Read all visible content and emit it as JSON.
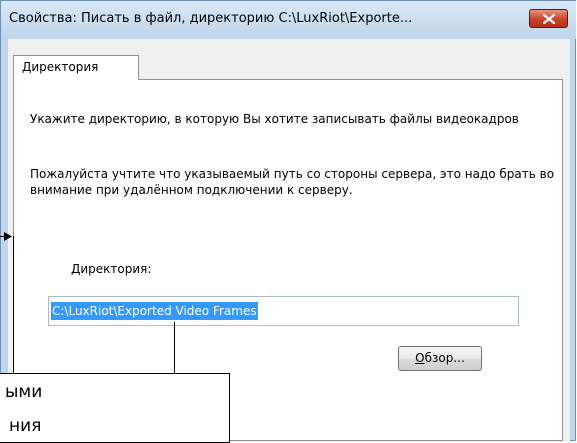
{
  "window": {
    "title": "Свойства: Писать в файл, директорию C:\\LuxRiot\\Exporte..."
  },
  "tabs": [
    {
      "label": "Директория",
      "active": true
    }
  ],
  "panel": {
    "instruction": "Укажите директорию, в которую Вы хотите записывать файлы видеокадров",
    "note": "Пожалуйста учтите что указываемый путь со стороны сервера, это надо брать во внимание при удалённом подключении к серверу.",
    "directory_label_first": "Д",
    "directory_label_rest": "иректория:",
    "directory_value": "C:\\LuxRiot\\Exported Video Frames",
    "browse_first": "О",
    "browse_rest": "бзор..."
  },
  "callout": {
    "line1": "ыми",
    "line2": "ния"
  },
  "colors": {
    "frame": "#bfd5ea",
    "close": "#c7432b",
    "selection": "#3399ff"
  },
  "icons": [
    "close-icon",
    "arrow-down-icon",
    "arrow-right-icon"
  ]
}
